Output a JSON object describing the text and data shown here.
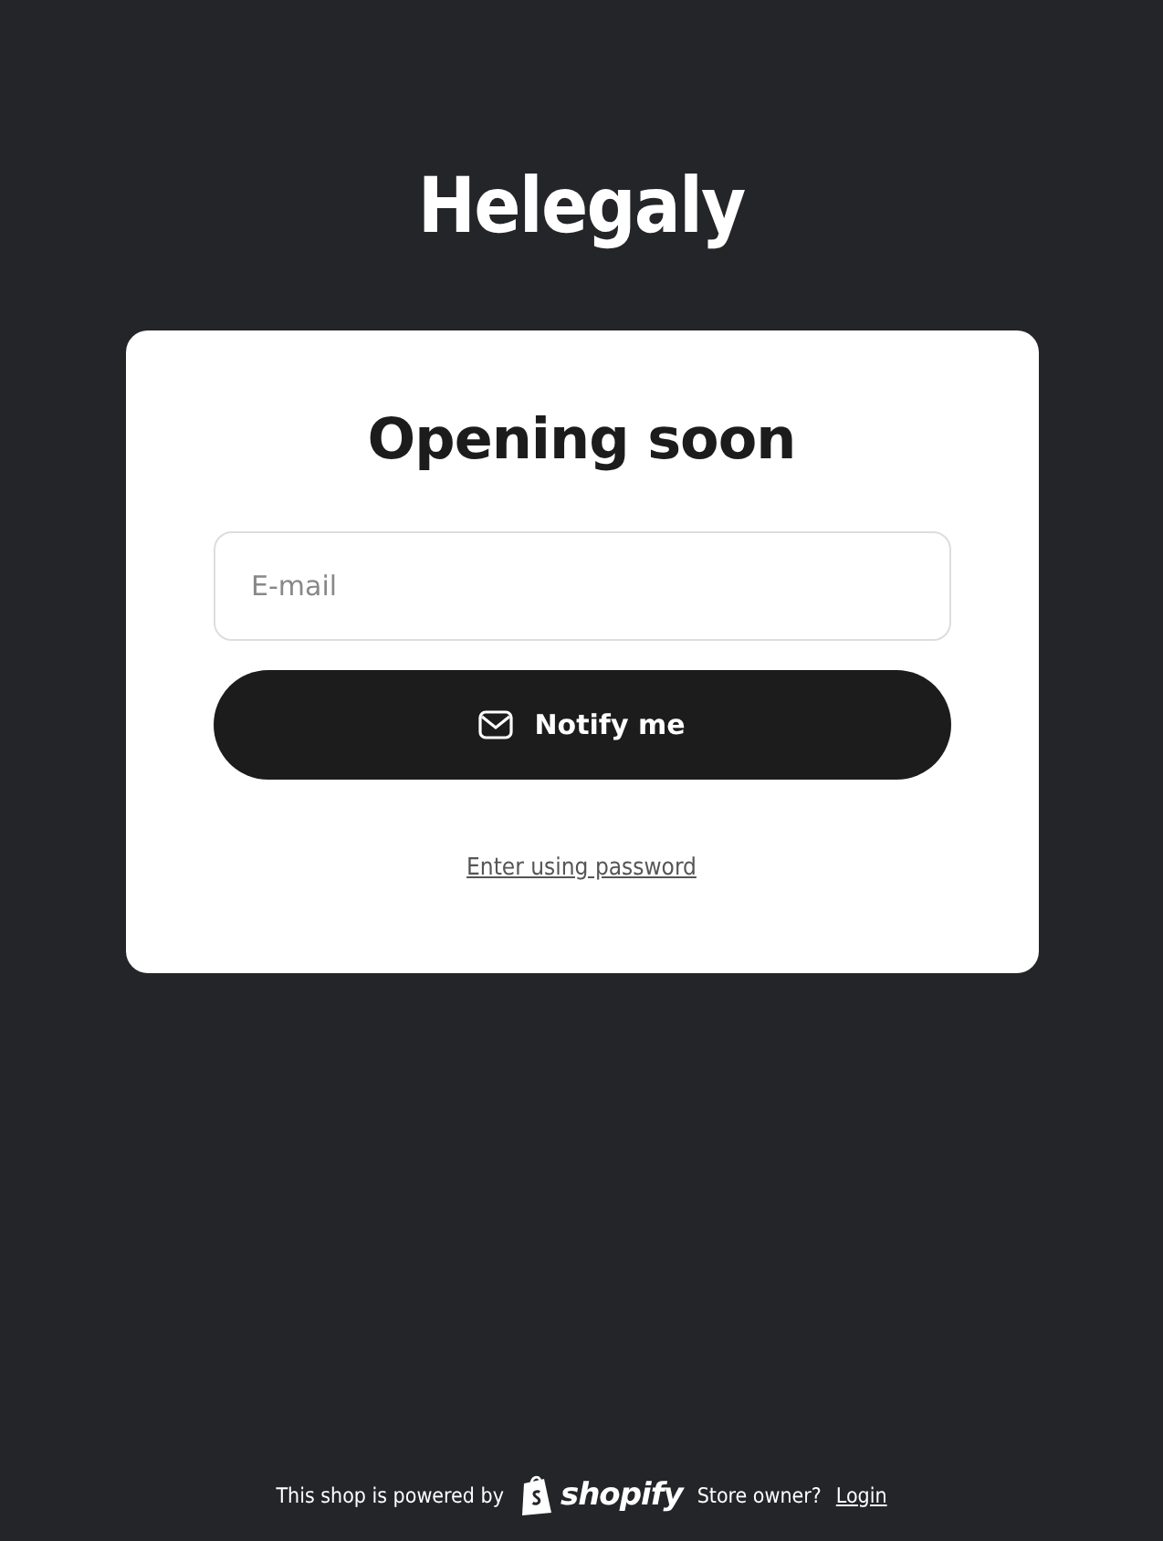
{
  "shop_name": "Helegaly",
  "card": {
    "heading": "Opening soon",
    "email_field": {
      "placeholder": "E-mail"
    },
    "notify_button": {
      "label": "Notify me"
    },
    "password_link": "Enter using password"
  },
  "footer": {
    "powered_by": "This shop is powered by",
    "platform_logo": "shopify",
    "owner_prompt": "Store owner?",
    "login_link": "Login"
  }
}
